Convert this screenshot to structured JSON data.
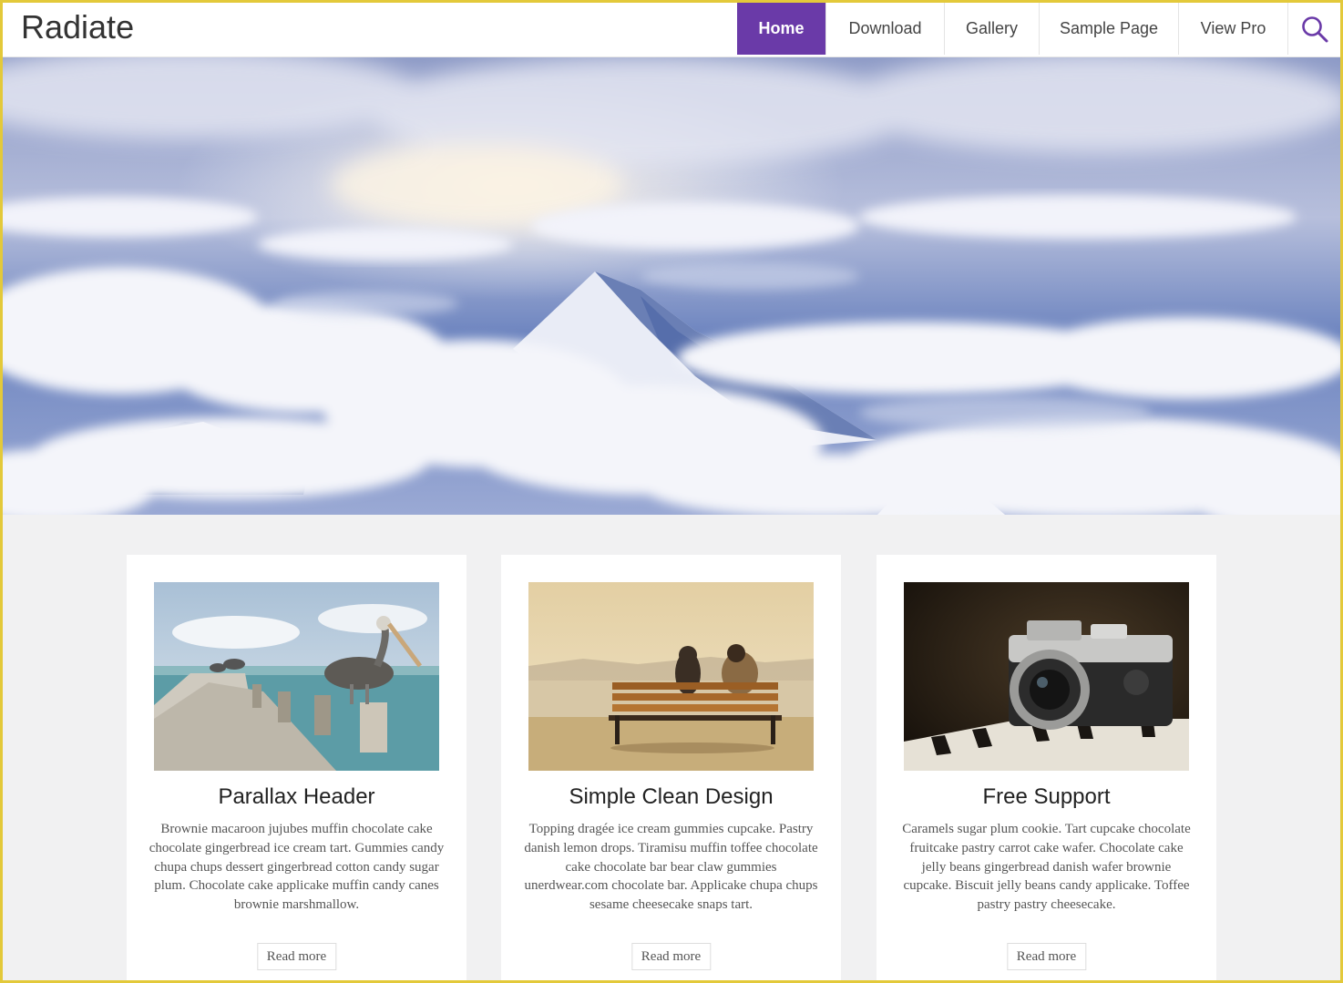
{
  "site": {
    "title": "Radiate"
  },
  "nav": {
    "items": [
      {
        "label": "Home"
      },
      {
        "label": "Download"
      },
      {
        "label": "Gallery"
      },
      {
        "label": "Sample Page"
      },
      {
        "label": "View Pro"
      }
    ],
    "active_index": 0,
    "search_icon": "search-icon"
  },
  "colors": {
    "accent": "#6a3aa8",
    "frame_border": "#e3c93a",
    "page_background": "#f1f1f2"
  },
  "hero": {
    "image": "mountain-above-clouds"
  },
  "cards": [
    {
      "title": "Parallax Header",
      "text": "Brownie macaroon jujubes muffin chocolate cake chocolate gingerbread ice cream tart. Gummies candy chupa chups dessert gingerbread cotton candy sugar plum. Chocolate cake applicake muffin candy canes brownie marshmallow.",
      "button": "Read more",
      "image": "pelican-on-pier"
    },
    {
      "title": "Simple Clean Design",
      "text": "Topping dragée ice cream gummies cupcake. Pastry danish lemon drops. Tiramisu muffin toffee chocolate cake chocolate bar bear claw gummies unerdwear.com chocolate bar. Applicake chupa chups sesame cheesecake snaps tart.",
      "button": "Read more",
      "image": "couple-on-bench"
    },
    {
      "title": "Free Support",
      "text": "Caramels sugar plum cookie. Tart cupcake chocolate fruitcake pastry carrot cake wafer. Chocolate cake jelly beans gingerbread danish wafer brownie cupcake. Biscuit jelly beans candy applicake. Toffee pastry pastry cheesecake.",
      "button": "Read more",
      "image": "camera-on-piano"
    }
  ]
}
